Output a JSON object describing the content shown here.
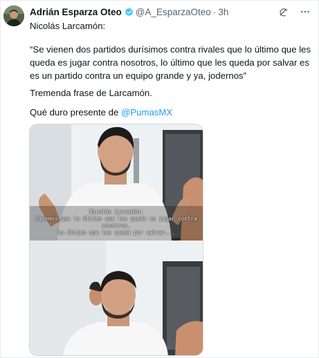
{
  "author": {
    "name": "Adrián Esparza Oteo",
    "handle": "@A_EsparzaOteo",
    "separator": "·",
    "time": "3h"
  },
  "tweet": {
    "line1": "Nicolás Larcamón:",
    "quote": "“Se vienen dos partidos durísimos contra rivales que lo último que les queda es jugar contra nosotros, lo último que les queda por salvar es es un partido contra un equipo grande y ya, jodernos”",
    "line3": "Tremenda frase de Larcamón.",
    "line4_prefix": "Qué duro presente de ",
    "mention": "@PumasMX"
  },
  "media": {
    "subtitle_name": "Nicolás Larcamón:",
    "subtitle_line1": "Sabemos que lo último que les queda es jugar contra nosotros,",
    "subtitle_line2": "lo último que les queda por salvar..."
  },
  "colors": {
    "accent": "#1d9bf0",
    "verified": "#40c4ff",
    "text": "#0f1419",
    "muted": "#536471"
  },
  "icons": {
    "header_action_1": "grok-icon",
    "header_action_2": "more-icon"
  }
}
